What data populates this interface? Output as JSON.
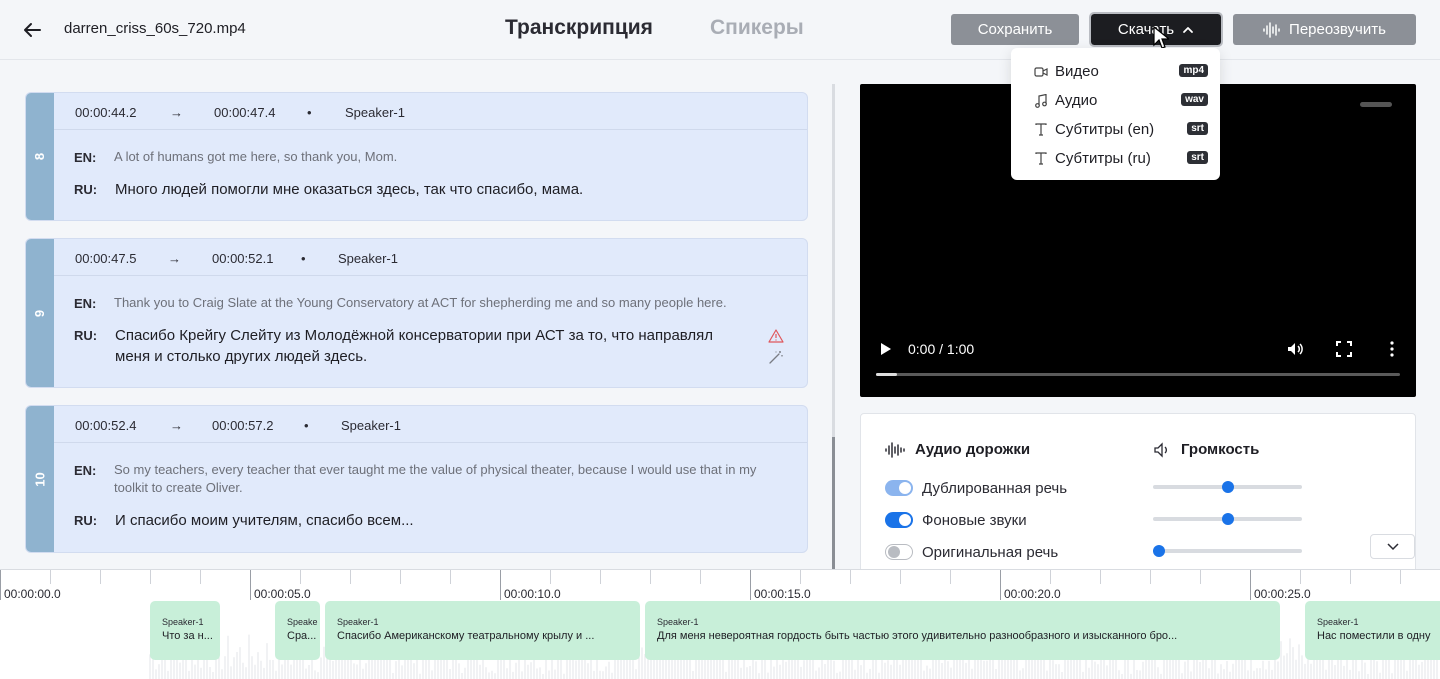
{
  "header": {
    "filename": "darren_criss_60s_720.mp4",
    "tabs": [
      {
        "label": "Транскрипция",
        "active": true
      },
      {
        "label": "Спикеры",
        "active": false
      }
    ],
    "save_label": "Сохранить",
    "download_label": "Скачать",
    "redub_label": "Переозвучить"
  },
  "download_menu": [
    {
      "label": "Видео",
      "badge": "mp4",
      "icon": "video-icon"
    },
    {
      "label": "Аудио",
      "badge": "wav",
      "icon": "music-note-icon"
    },
    {
      "label": "Субтитры (en)",
      "badge": "srt",
      "icon": "text-t-icon"
    },
    {
      "label": "Субтитры (ru)",
      "badge": "srt",
      "icon": "text-t-icon"
    }
  ],
  "segments": [
    {
      "num": "8",
      "start": "00:00:44.2",
      "arrow": "→",
      "end": "00:00:47.4",
      "dot": "•",
      "speaker": "Speaker-1",
      "en_label": "EN:",
      "en": "A lot of humans got me here, so thank you, Mom.",
      "ru_label": "RU:",
      "ru": "Много людей помогли мне оказаться здесь, так что спасибо, мама."
    },
    {
      "num": "9",
      "start": "00:00:47.5",
      "arrow": "→",
      "end": "00:00:52.1",
      "dot": "•",
      "speaker": "Speaker-1",
      "en_label": "EN:",
      "en": "Thank you to Craig Slate at the Young Conservatory at ACT for shepherding me and so many people here.",
      "ru_label": "RU:",
      "ru": "Спасибо Крейгу Слейту из Молодёжной консерватории при АСТ за то, что направлял меня и столько других людей здесь."
    },
    {
      "num": "10",
      "start": "00:00:52.4",
      "arrow": "→",
      "end": "00:00:57.2",
      "dot": "•",
      "speaker": "Speaker-1",
      "en_label": "EN:",
      "en": "So my teachers, every teacher that ever taught me the value of physical theater, because I would use that in my toolkit to create Oliver.",
      "ru_label": "RU:",
      "ru": "И спасибо моим учителям, спасибо всем..."
    }
  ],
  "video": {
    "time": "0:00 / 1:00",
    "progress": 0.04
  },
  "audio": {
    "tracks_title": "Аудио дорожки",
    "volume_title": "Громкость",
    "tracks": [
      {
        "label": "Дублированная речь",
        "state": "on-light",
        "volume": 0.5
      },
      {
        "label": "Фоновые звуки",
        "state": "on",
        "volume": 0.5
      },
      {
        "label": "Оригинальная речь",
        "state": "off",
        "volume": 0.04
      }
    ]
  },
  "timeline": {
    "labels": [
      "00:00:00.0",
      "00:00:05.0",
      "00:00:10.0",
      "00:00:15.0",
      "00:00:20.0",
      "00:00:25.0"
    ],
    "clips": [
      {
        "speaker": "Speaker-1",
        "text": "Что за н..."
      },
      {
        "speaker": "Speake",
        "text": "Сра..."
      },
      {
        "speaker": "Speaker-1",
        "text": "Спасибо Американскому театральному крылу и ..."
      },
      {
        "speaker": "Speaker-1",
        "text": "Для меня невероятная гордость быть частью этого удивительно разнообразного и изысканного бро..."
      },
      {
        "speaker": "Speaker-1",
        "text": "Нас поместили в одну"
      }
    ]
  },
  "colors": {
    "accent": "#1a73e8",
    "segment_bg": "#e1eafb",
    "segment_num": "#8fb3cf",
    "clip": "#c8efd9",
    "warning": "#e0565b"
  }
}
